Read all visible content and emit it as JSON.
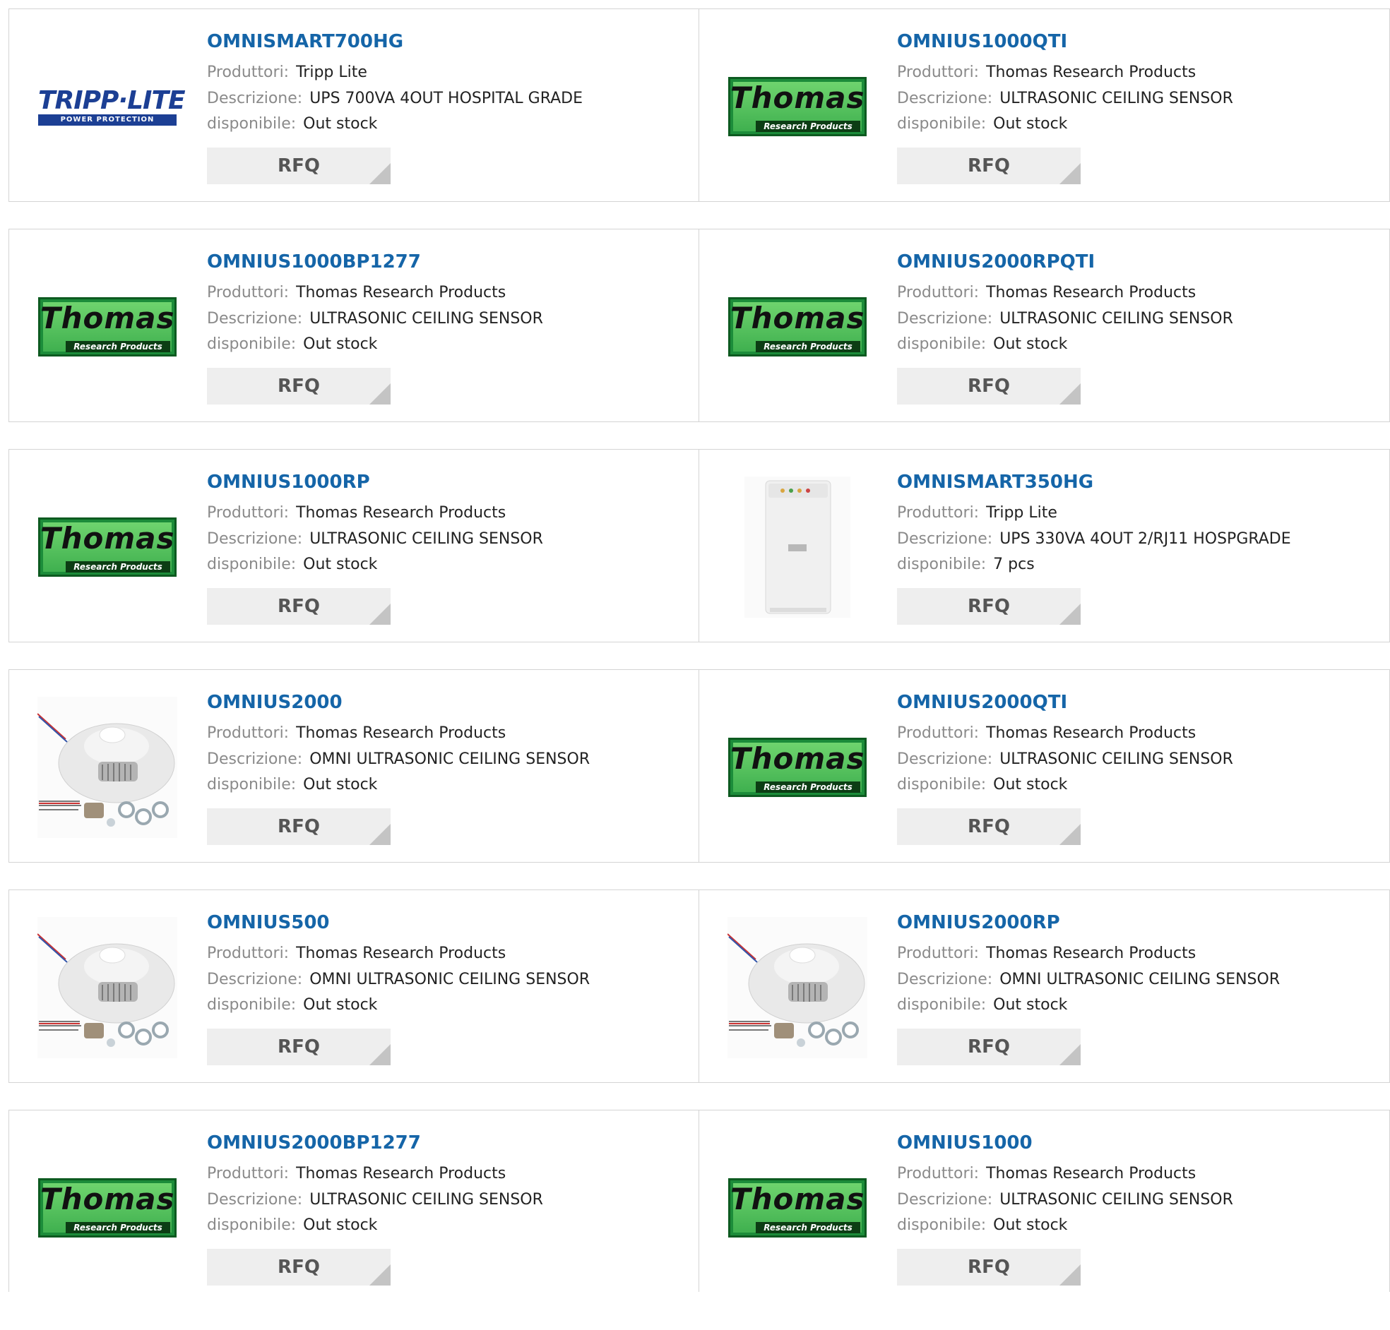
{
  "labels": {
    "manufacturer": "Produttori:",
    "description": "Descrizione:",
    "availability": "disponibile:",
    "rfq": "RFQ"
  },
  "logos": {
    "thomas_word": "Thomas",
    "thomas_sub": "Research Products",
    "tripp_word": "TRIPP·LITE",
    "tripp_sub": "POWER PROTECTION"
  },
  "products": [
    {
      "part": "OMNISMART700HG",
      "manufacturer": "Tripp Lite",
      "description": "UPS 700VA 4OUT HOSPITAL GRADE",
      "availability": "Out stock",
      "image": "tripp-lite-logo"
    },
    {
      "part": "OMNIUS1000QTI",
      "manufacturer": "Thomas Research Products",
      "description": "ULTRASONIC CEILING SENSOR",
      "availability": "Out stock",
      "image": "thomas-logo"
    },
    {
      "part": "OMNIUS1000BP1277",
      "manufacturer": "Thomas Research Products",
      "description": "ULTRASONIC CEILING SENSOR",
      "availability": "Out stock",
      "image": "thomas-logo"
    },
    {
      "part": "OMNIUS2000RPQTI",
      "manufacturer": "Thomas Research Products",
      "description": "ULTRASONIC CEILING SENSOR",
      "availability": "Out stock",
      "image": "thomas-logo"
    },
    {
      "part": "OMNIUS1000RP",
      "manufacturer": "Thomas Research Products",
      "description": "ULTRASONIC CEILING SENSOR",
      "availability": "Out stock",
      "image": "thomas-logo"
    },
    {
      "part": "OMNISMART350HG",
      "manufacturer": "Tripp Lite",
      "description": "UPS 330VA 4OUT 2/RJ11 HOSPGRADE",
      "availability": "7 pcs",
      "image": "ups-tower-photo"
    },
    {
      "part": "OMNIUS2000",
      "manufacturer": "Thomas Research Products",
      "description": "OMNI ULTRASONIC CEILING SENSOR",
      "availability": "Out stock",
      "image": "ceiling-sensor-photo"
    },
    {
      "part": "OMNIUS2000QTI",
      "manufacturer": "Thomas Research Products",
      "description": "ULTRASONIC CEILING SENSOR",
      "availability": "Out stock",
      "image": "thomas-logo"
    },
    {
      "part": "OMNIUS500",
      "manufacturer": "Thomas Research Products",
      "description": "OMNI ULTRASONIC CEILING SENSOR",
      "availability": "Out stock",
      "image": "ceiling-sensor-photo"
    },
    {
      "part": "OMNIUS2000RP",
      "manufacturer": "Thomas Research Products",
      "description": "OMNI ULTRASONIC CEILING SENSOR",
      "availability": "Out stock",
      "image": "ceiling-sensor-photo"
    },
    {
      "part": "OMNIUS2000BP1277",
      "manufacturer": "Thomas Research Products",
      "description": "ULTRASONIC CEILING SENSOR",
      "availability": "Out stock",
      "image": "thomas-logo"
    },
    {
      "part": "OMNIUS1000",
      "manufacturer": "Thomas Research Products",
      "description": "ULTRASONIC CEILING SENSOR",
      "availability": "Out stock",
      "image": "thomas-logo"
    }
  ],
  "colors": {
    "link": "#1565a8",
    "label": "#8a8a8a",
    "border": "#d4d4d4",
    "button_bg": "#eeeeee",
    "thomas_green": "#3fb04f",
    "tripp_blue": "#1c3f94"
  }
}
